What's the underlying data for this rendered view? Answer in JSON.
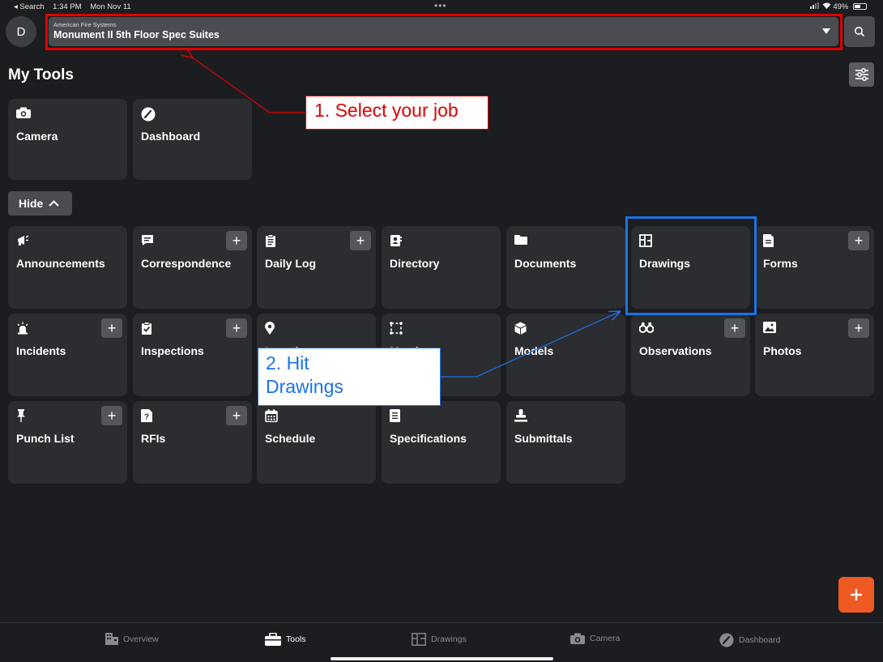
{
  "status_bar": {
    "back_label": "◂ Search",
    "time": "1:34 PM",
    "date": "Mon Nov 11",
    "battery": "49%"
  },
  "header": {
    "avatar_initial": "D",
    "company": "American Fire Systems",
    "project": "Monument II 5th Floor Spec Suites",
    "search_icon": "search-icon"
  },
  "my_tools": {
    "title": "My Tools",
    "items": [
      {
        "label": "Camera",
        "icon": "camera-icon"
      },
      {
        "label": "Dashboard",
        "icon": "gauge-icon"
      }
    ]
  },
  "hide_label": "Hide",
  "tools": [
    {
      "label": "Announcements",
      "icon": "megaphone-icon",
      "add": false
    },
    {
      "label": "Correspondence",
      "icon": "chat-icon",
      "add": true
    },
    {
      "label": "Daily Log",
      "icon": "clipboard-icon",
      "add": true
    },
    {
      "label": "Directory",
      "icon": "contact-book-icon",
      "add": false
    },
    {
      "label": "Documents",
      "icon": "folder-icon",
      "add": false
    },
    {
      "label": "Drawings",
      "icon": "floorplan-icon",
      "add": false
    },
    {
      "label": "Forms",
      "icon": "form-icon",
      "add": true
    },
    {
      "label": "Incidents",
      "icon": "alarm-icon",
      "add": true
    },
    {
      "label": "Inspections",
      "icon": "clipboard-check-icon",
      "add": true
    },
    {
      "label": "Locations",
      "icon": "pin-icon",
      "add": false
    },
    {
      "label": "Meetings",
      "icon": "meeting-icon",
      "add": false
    },
    {
      "label": "Models",
      "icon": "cube-icon",
      "add": false
    },
    {
      "label": "Observations",
      "icon": "binoculars-icon",
      "add": true
    },
    {
      "label": "Photos",
      "icon": "image-icon",
      "add": true
    },
    {
      "label": "Punch List",
      "icon": "pushpin-icon",
      "add": true
    },
    {
      "label": "RFIs",
      "icon": "question-icon",
      "add": true
    },
    {
      "label": "Schedule",
      "icon": "calendar-icon",
      "add": false
    },
    {
      "label": "Specifications",
      "icon": "document-lines-icon",
      "add": false
    },
    {
      "label": "Submittals",
      "icon": "stamp-icon",
      "add": false
    }
  ],
  "plus_label": "+",
  "annotations": {
    "step1": "1. Select your job",
    "step2_line1": "2. Hit",
    "step2_line2": "Drawings"
  },
  "tabbar": [
    {
      "label": "Overview",
      "icon": "building-icon",
      "active": false
    },
    {
      "label": "Tools",
      "icon": "toolbox-icon",
      "active": true
    },
    {
      "label": "Drawings",
      "icon": "floorplan-icon",
      "active": false
    },
    {
      "label": "Camera",
      "icon": "camera-icon",
      "active": false
    },
    {
      "label": "Dashboard",
      "icon": "gauge-icon",
      "active": false
    }
  ],
  "colors": {
    "background": "#1c1d20",
    "tile": "#2c2d31",
    "accent_fab": "#ef5a24",
    "annotation_red": "#e00000",
    "annotation_blue": "#1a73e8"
  }
}
